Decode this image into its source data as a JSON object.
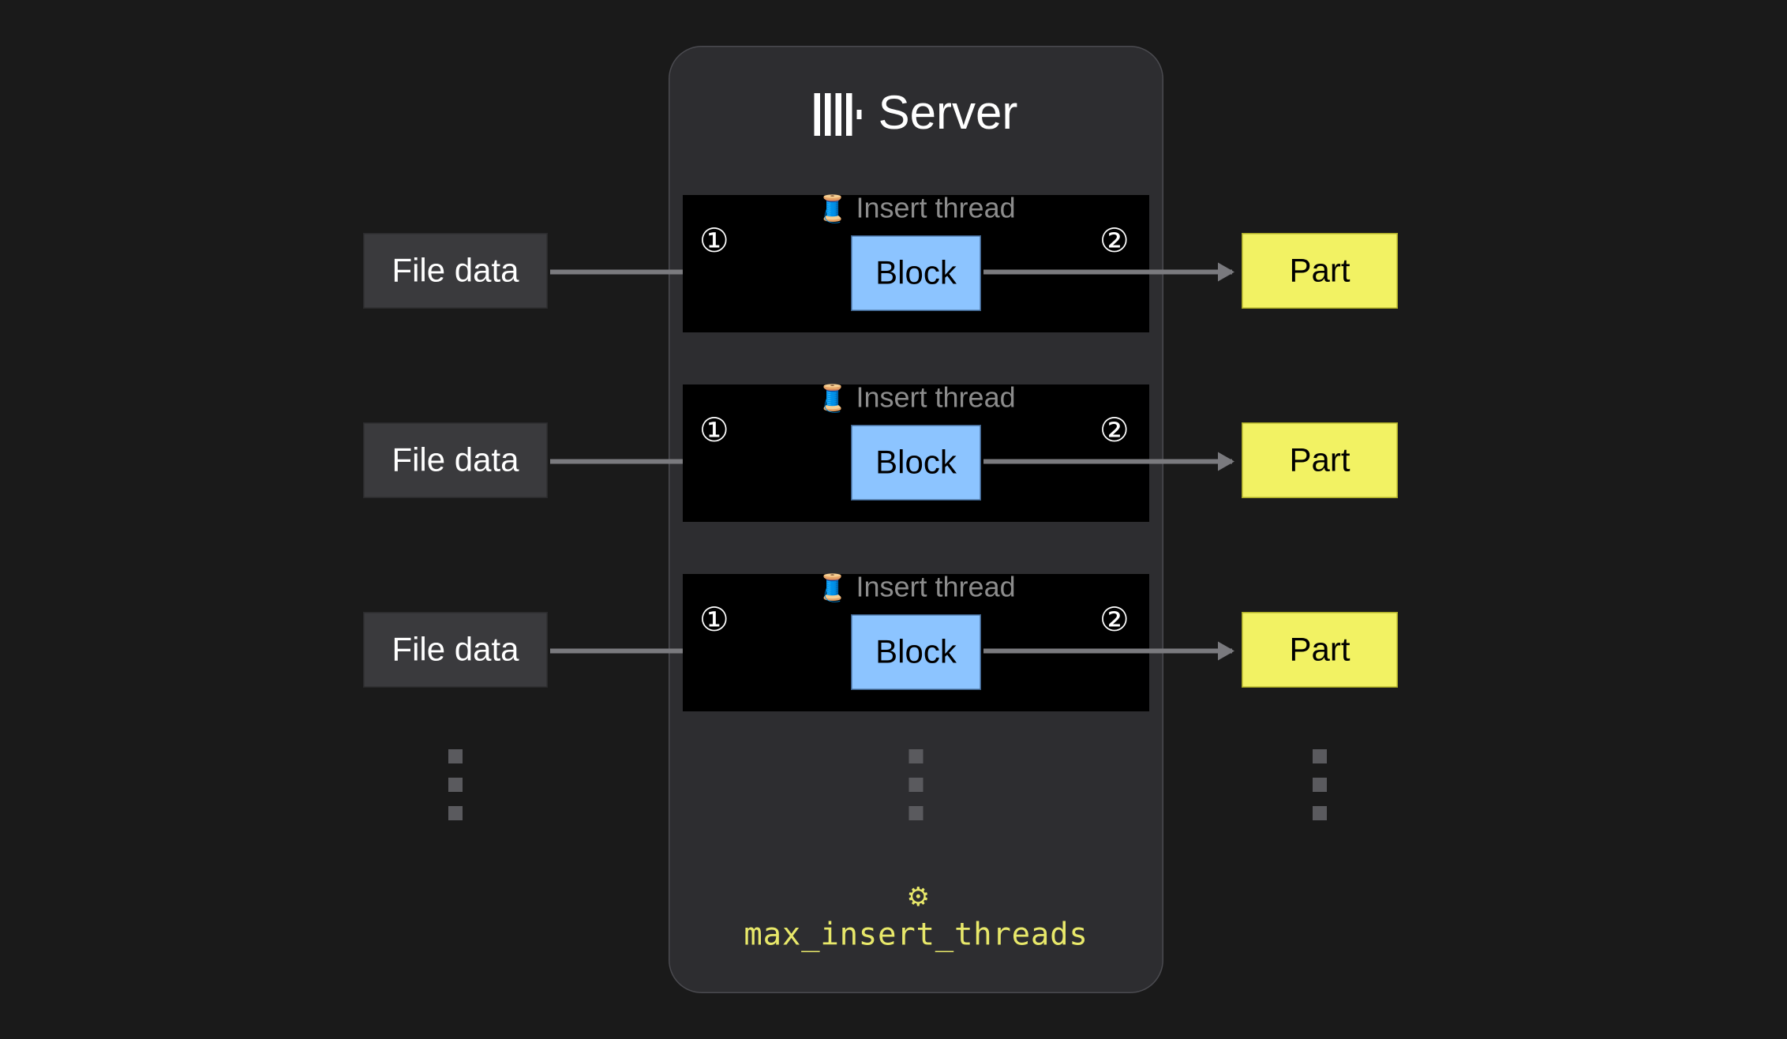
{
  "server": {
    "title": "Server"
  },
  "rows": [
    {
      "file_label": "File data",
      "thread_label": "Insert thread",
      "step1": "①",
      "block_label": "Block",
      "step2": "②",
      "part_label": "Part"
    },
    {
      "file_label": "File data",
      "thread_label": "Insert thread",
      "step1": "①",
      "block_label": "Block",
      "step2": "②",
      "part_label": "Part"
    },
    {
      "file_label": "File data",
      "thread_label": "Insert thread",
      "step1": "①",
      "block_label": "Block",
      "step2": "②",
      "part_label": "Part"
    }
  ],
  "setting": {
    "name": "max_insert_threads"
  },
  "icons": {
    "spool": "🧵",
    "gear": "⚙"
  }
}
